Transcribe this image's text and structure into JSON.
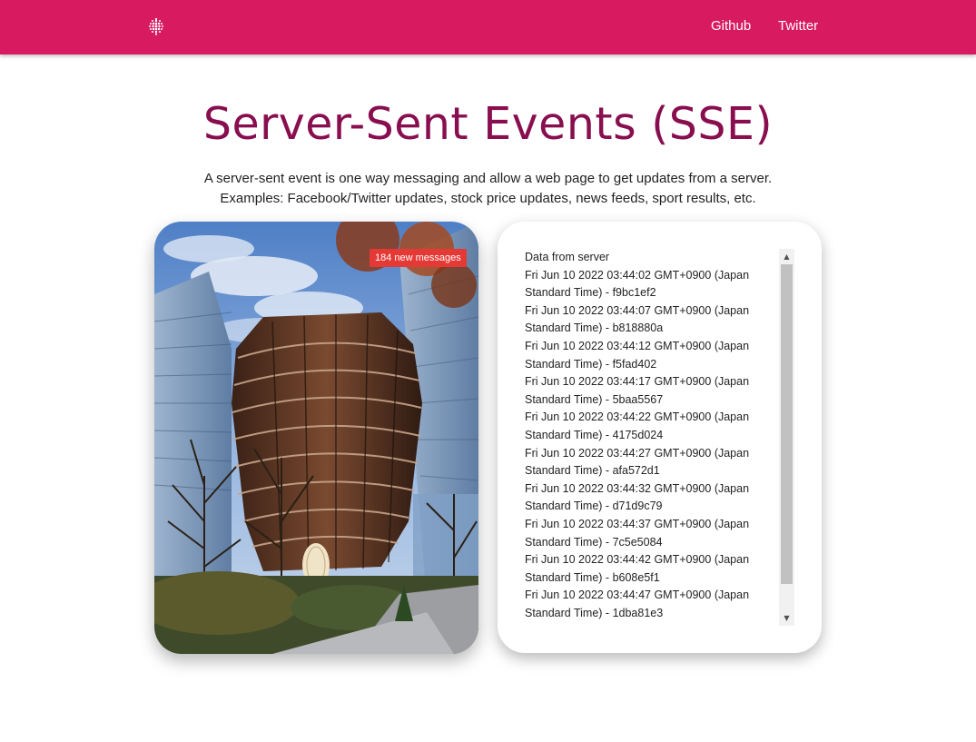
{
  "nav": {
    "logo_icon": "dotted-sphere-icon",
    "links": [
      {
        "label": "Github"
      },
      {
        "label": "Twitter"
      }
    ]
  },
  "header": {
    "title": "Server-Sent Events (SSE)",
    "description_line1": "A server-sent event is one way messaging and allow a web page to get updates from a server.",
    "description_line2": "Examples: Facebook/Twitter updates, stock price updates, news feeds, sport results, etc."
  },
  "photo_card": {
    "badge": "184 new messages"
  },
  "log": {
    "heading": "Data from server",
    "entries": [
      "Fri Jun 10 2022 03:44:02 GMT+0900 (Japan Standard Time) - f9bc1ef2",
      "Fri Jun 10 2022 03:44:07 GMT+0900 (Japan Standard Time) - b818880a",
      "Fri Jun 10 2022 03:44:12 GMT+0900 (Japan Standard Time) - f5fad402",
      "Fri Jun 10 2022 03:44:17 GMT+0900 (Japan Standard Time) - 5baa5567",
      "Fri Jun 10 2022 03:44:22 GMT+0900 (Japan Standard Time) - 4175d024",
      "Fri Jun 10 2022 03:44:27 GMT+0900 (Japan Standard Time) - afa572d1",
      "Fri Jun 10 2022 03:44:32 GMT+0900 (Japan Standard Time) - d71d9c79",
      "Fri Jun 10 2022 03:44:37 GMT+0900 (Japan Standard Time) - 7c5e5084",
      "Fri Jun 10 2022 03:44:42 GMT+0900 (Japan Standard Time) - b608e5f1",
      "Fri Jun 10 2022 03:44:47 GMT+0900 (Japan Standard Time) - 1dba81e3"
    ]
  },
  "colors": {
    "topbar": "#d81b60",
    "title": "#880e4f",
    "badge": "#e53935"
  }
}
